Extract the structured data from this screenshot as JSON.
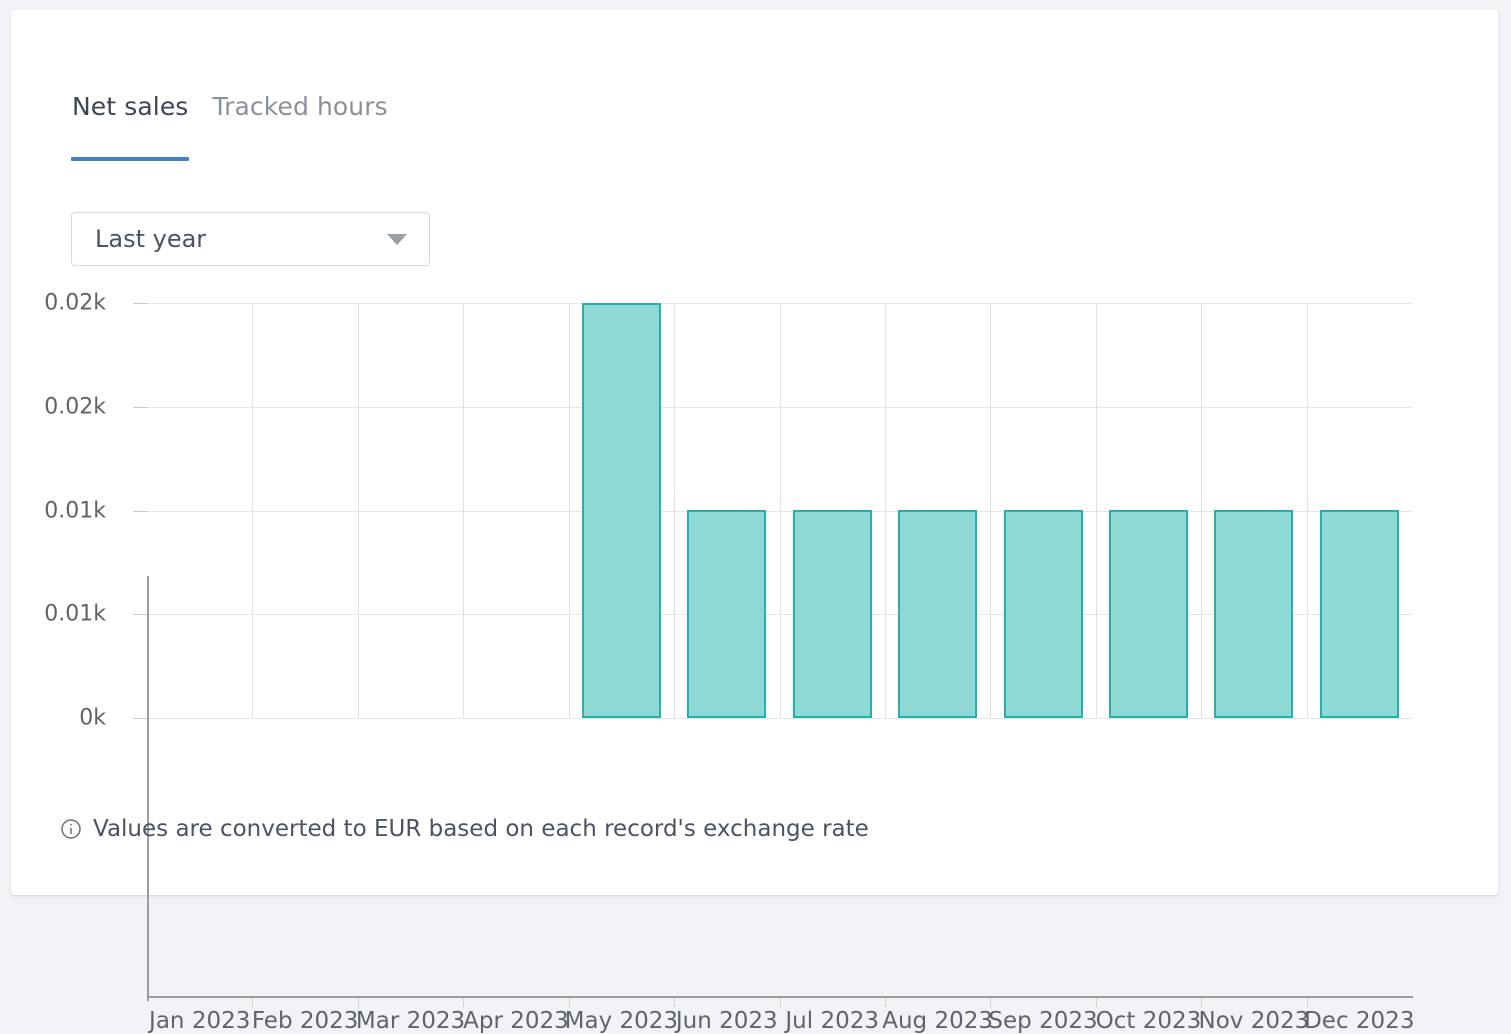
{
  "card": {
    "background": "#ffffff",
    "page_background": "#f1f3f7"
  },
  "tabs": {
    "items": [
      {
        "label": "Net sales",
        "active": true
      },
      {
        "label": "Tracked hours",
        "active": false
      }
    ],
    "active_underline_color": "#3f7fd3",
    "active_text_color": "#3d4653",
    "inactive_text_color": "#8b9199"
  },
  "range_select": {
    "name": "date-range-select",
    "value": "Last year",
    "placeholder": "Last year",
    "icon": "chevron-down-icon"
  },
  "footnote": {
    "icon": "info-circle-icon",
    "text": "Values are converted to EUR based on each record's exchange rate"
  },
  "chart_data": {
    "type": "bar",
    "title": "",
    "subtitle": "",
    "xlabel": "",
    "ylabel": "",
    "categories": [
      "Jan 2023",
      "Feb 2023",
      "Mar 2023",
      "Apr 2023",
      "May 2023",
      "Jun 2023",
      "Jul 2023",
      "Aug 2023",
      "Sep 2023",
      "Oct 2023",
      "Nov 2023",
      "Dec 2023"
    ],
    "values": [
      0,
      0,
      0,
      0,
      0.02,
      0.01,
      0.01,
      0.01,
      0.01,
      0.01,
      0.01,
      0.01
    ],
    "value_unit": "k",
    "ylim": [
      0,
      0.02
    ],
    "ytick_labels": [
      "0.02k",
      "0.02k",
      "0.01k",
      "0.01k",
      "0k"
    ],
    "ytick_fractions": [
      1,
      0.75,
      0.5,
      0.25,
      0
    ],
    "bar_fill_color": "#8fd9d5",
    "bar_border_color": "#27b0ae",
    "grid": true,
    "grid_color": "#e6e6e6",
    "axis_color": "#9c9c9c",
    "legend": null,
    "legend_position": "none",
    "currency": "EUR"
  }
}
